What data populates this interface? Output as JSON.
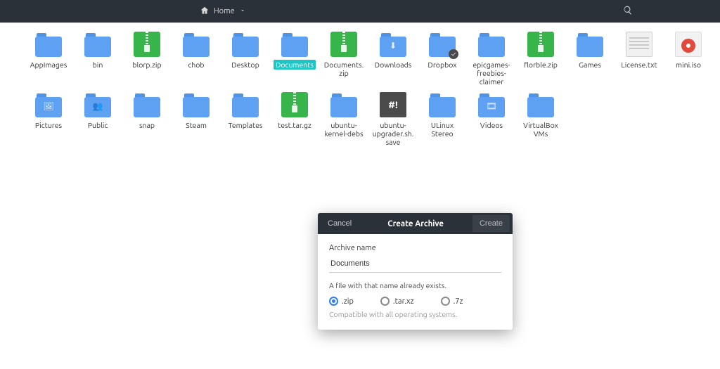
{
  "header": {
    "path_label": "Home"
  },
  "files": [
    {
      "name": "AppImages",
      "kind": "folder"
    },
    {
      "name": "bin",
      "kind": "folder"
    },
    {
      "name": "blorp.zip",
      "kind": "archive"
    },
    {
      "name": "chob",
      "kind": "folder"
    },
    {
      "name": "Desktop",
      "kind": "folder"
    },
    {
      "name": "Documents",
      "kind": "folder",
      "selected": true
    },
    {
      "name": "Documents.zip",
      "kind": "archive"
    },
    {
      "name": "Downloads",
      "kind": "folder",
      "glyph": "⬇"
    },
    {
      "name": "Dropbox",
      "kind": "folder",
      "badge": "✓"
    },
    {
      "name": "epicgames-freebies-claimer",
      "kind": "folder"
    },
    {
      "name": "florble.zip",
      "kind": "archive"
    },
    {
      "name": "Games",
      "kind": "folder"
    },
    {
      "name": "License.txt",
      "kind": "file"
    },
    {
      "name": "mini.iso",
      "kind": "iso"
    },
    {
      "name": "Pictures",
      "kind": "folder",
      "glyph": "🖼"
    },
    {
      "name": "Public",
      "kind": "folder",
      "glyph": "👥"
    },
    {
      "name": "snap",
      "kind": "folder"
    },
    {
      "name": "Steam",
      "kind": "folder"
    },
    {
      "name": "Templates",
      "kind": "folder"
    },
    {
      "name": "test.tar.gz",
      "kind": "archive"
    },
    {
      "name": "ubuntu-kernel-debs",
      "kind": "folder"
    },
    {
      "name": "ubuntu-upgrader.sh.save",
      "kind": "script"
    },
    {
      "name": "ULinux Stereo",
      "kind": "folder"
    },
    {
      "name": "Videos",
      "kind": "folder",
      "glyph": "🎞"
    },
    {
      "name": "VirtualBox VMs",
      "kind": "folder"
    }
  ],
  "dialog": {
    "cancel": "Cancel",
    "title": "Create Archive",
    "create": "Create",
    "field_label": "Archive name",
    "value": "Documents",
    "warning": "A file with that name already exists.",
    "formats": [
      {
        "label": ".zip",
        "checked": true
      },
      {
        "label": ".tar.xz",
        "checked": false
      },
      {
        "label": ".7z",
        "checked": false
      }
    ],
    "compat": "Compatible with all operating systems."
  }
}
